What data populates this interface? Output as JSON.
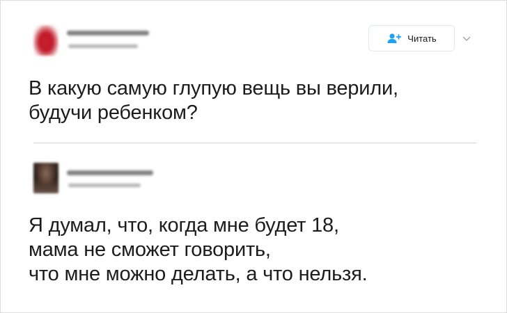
{
  "first_tweet": {
    "author_avatar": "avatar-blurred",
    "follow_button": {
      "label": "Читать",
      "icon": "add-user-icon"
    },
    "menu_icon": "chevron-down-icon",
    "text_lines": [
      "В какую самую глупую вещь вы верили,",
      "будучи ребенком?"
    ]
  },
  "second_tweet": {
    "author_avatar": "avatar-blurred",
    "text_lines": [
      "Я думал, что, когда мне будет 18,",
      "мама не сможет говорить,",
      "что мне можно делать, а что нельзя."
    ]
  },
  "colors": {
    "accent": "#1da1f2",
    "text": "#14171a",
    "border": "#e1e8ed"
  }
}
